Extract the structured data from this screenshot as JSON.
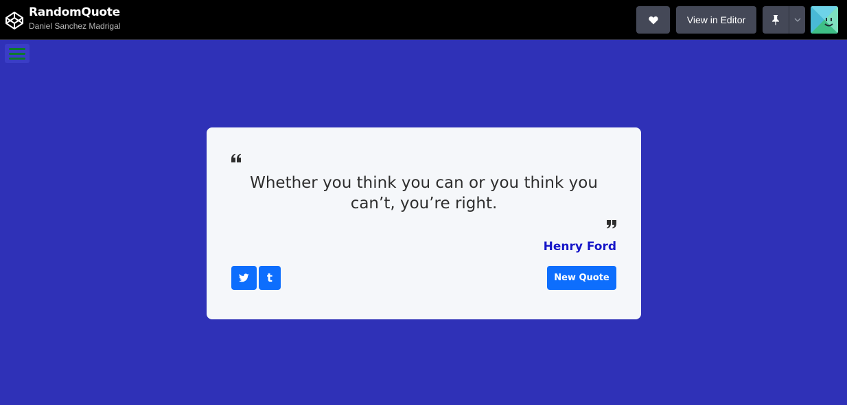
{
  "header": {
    "title": "RandomQuote",
    "author": "Daniel Sanchez Madrigal",
    "heart_icon": "heart-icon",
    "view_in_editor_label": "View in Editor",
    "pin_icon": "pin-icon",
    "caret_icon": "chevron-down-icon",
    "avatar_icon": "smiley-avatar"
  },
  "menu": {
    "icon": "hamburger-icon"
  },
  "quote": {
    "text": "Whether you think you can or you think you can’t, you’re right.",
    "author": "Henry Ford"
  },
  "actions": {
    "twitter_icon": "twitter-icon",
    "tumblr_label": "t",
    "new_quote_label": "New Quote"
  },
  "colors": {
    "background": "#2f31b7",
    "card": "#f5f7fa",
    "accent": "#0d6efd",
    "author": "#1616c8",
    "topbar": "#000000",
    "menu_bars": "#0c7a2c"
  }
}
